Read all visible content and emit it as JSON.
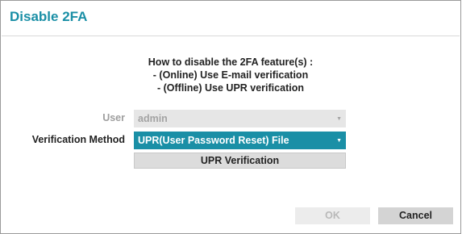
{
  "dialog": {
    "title": "Disable 2FA",
    "instructions": [
      "How to disable the 2FA feature(s) :",
      "- (Online) Use E-mail verification",
      "- (Offline) Use UPR verification"
    ]
  },
  "form": {
    "user_label": "User",
    "user_value": "admin",
    "method_label": "Verification Method",
    "method_value": "UPR(User Password Reset) File",
    "upr_button_label": "UPR Verification"
  },
  "footer": {
    "ok_label": "OK",
    "cancel_label": "Cancel"
  },
  "icons": {
    "dropdown": "chevron-down-icon"
  },
  "colors": {
    "accent": "#1a8fa6",
    "disabled_text": "#a3a3a3"
  }
}
